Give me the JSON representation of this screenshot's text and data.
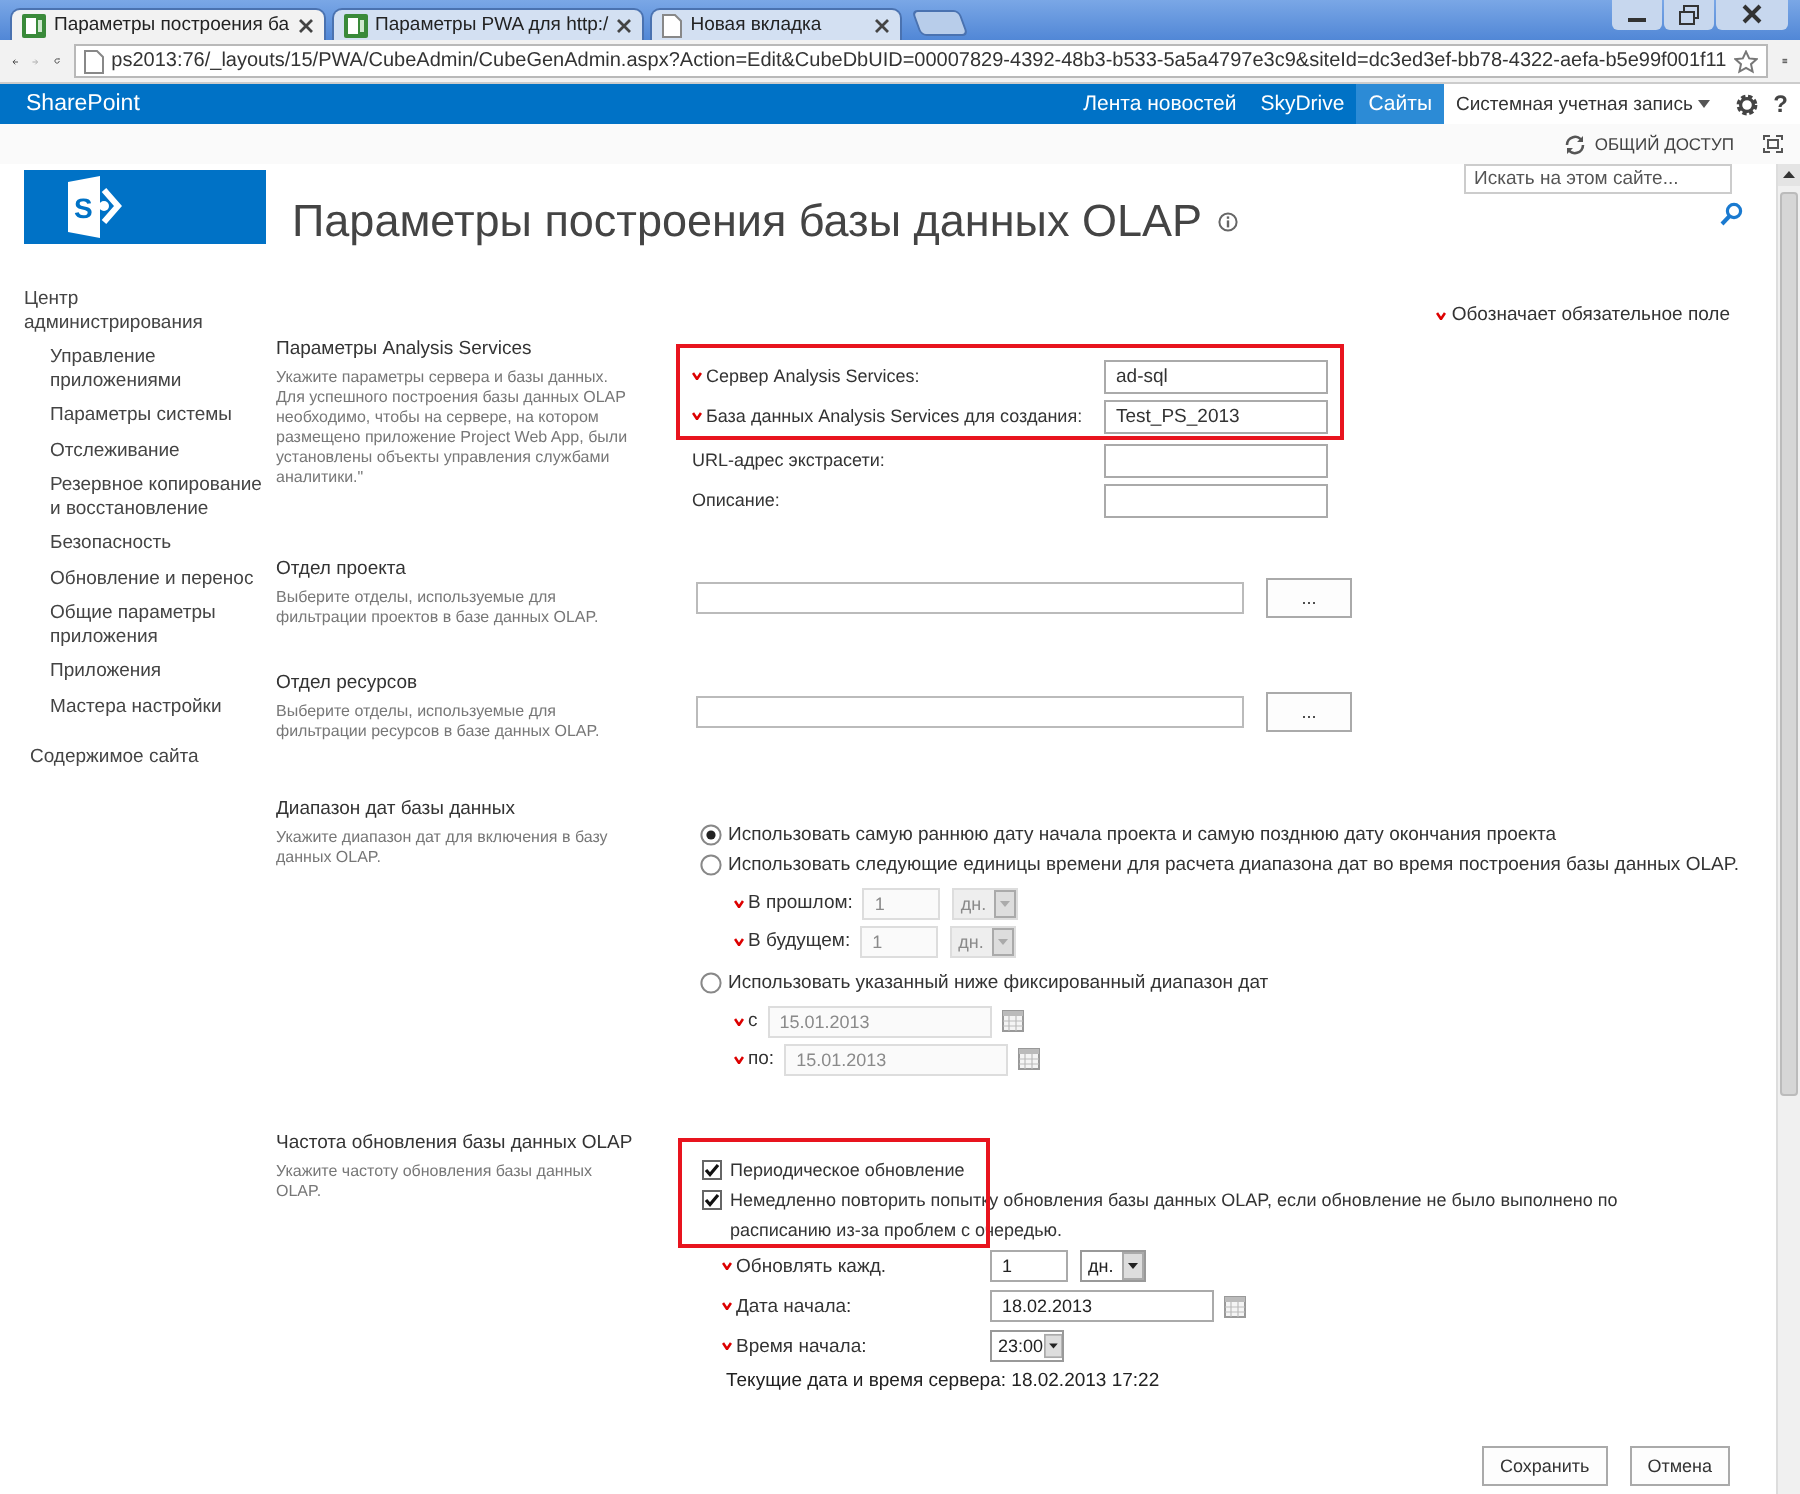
{
  "browser": {
    "tabs": [
      {
        "label": "Параметры построения ба",
        "selected": true
      },
      {
        "label": "Параметры PWA для http:/",
        "selected": false
      },
      {
        "label": "Новая вкладка",
        "selected": false
      }
    ],
    "url": "ps2013:76/_layouts/15/PWA/CubeAdmin/CubeGenAdmin.aspx?Action=Edit&CubeDbUID=00007829-4392-48b3-b533-5a5a4797e3c9&siteId=dc3ed3ef-bb78-4322-aefa-b5e99f001f11"
  },
  "suite_bar": {
    "brand": "SharePoint",
    "links": [
      {
        "label": "Лента новостей",
        "selected": false
      },
      {
        "label": "SkyDrive",
        "selected": false
      },
      {
        "label": "Сайты",
        "selected": true
      }
    ],
    "user": "Системная учетная запись",
    "help": "?"
  },
  "share": "ОБЩИЙ ДОСТУП",
  "logo_letter": "S",
  "page_title": "Параметры построения базы данных OLAP",
  "search": {
    "placeholder": "Искать на этом сайте..."
  },
  "nav": {
    "title": "Центр администрирования",
    "items": [
      "Управление приложениями",
      "Параметры системы",
      "Отслеживание",
      "Резервное копирование и восстановление",
      "Безопасность",
      "Обновление и перенос",
      "Общие параметры приложения",
      "Приложения",
      "Мастера настройки"
    ],
    "footer": "Содержимое сайта"
  },
  "required_note": "Обозначает обязательное поле",
  "sections": [
    {
      "kind": "fields",
      "title": "Параметры Analysis Services",
      "description": "Укажите параметры сервера и базы данных. Для успешного построения базы данных OLAP необходимо, чтобы на сервере, на котором размещено приложение Project Web App, были установлены объекты управления службами аналитики.\"",
      "fields": [
        {
          "label": "Сервер Analysis Services:",
          "required": true,
          "value": "ad-sql",
          "highlighted": true
        },
        {
          "label": "База данных Analysis Services для создания:",
          "required": true,
          "value": "Test_PS_2013",
          "highlighted": true
        },
        {
          "label": "URL-адрес экстрасети:",
          "required": false,
          "highlighted": false
        },
        {
          "label": "Описание:",
          "required": false,
          "highlighted": false
        }
      ]
    },
    {
      "kind": "picker",
      "title": "Отдел проекта",
      "description": "Выберите отделы, используемые для фильтрации проектов в базе данных OLAP.",
      "button": "..."
    },
    {
      "kind": "picker",
      "title": "Отдел ресурсов",
      "description": "Выберите отделы, используемые для фильтрации ресурсов в базе данных OLAP.",
      "button": "..."
    },
    {
      "kind": "date_range",
      "title": "Диапазон дат базы данных",
      "description": "Укажите диапазон дат для включения в базу данных OLAP.",
      "options": [
        {
          "label": "Использовать самую раннюю дату начала проекта и самую позднюю дату окончания проекта",
          "selected": true
        },
        {
          "label": "Использовать следующие единицы времени для расчета диапазона дат во время построения базы данных OLAP.",
          "selected": false,
          "fields": [
            {
              "kind": "number_unit",
              "label": "В прошлом:",
              "required": true,
              "value": "1",
              "unit": "дн.",
              "disabled": true
            },
            {
              "kind": "number_unit",
              "label": "В будущем:",
              "required": true,
              "value": "1",
              "unit": "дн.",
              "disabled": true
            }
          ]
        },
        {
          "label": "Использовать указанный ниже фиксированный диапазон дат",
          "selected": false,
          "fields": [
            {
              "kind": "date",
              "label": "с",
              "required": true,
              "value": "15.01.2013",
              "disabled": true
            },
            {
              "kind": "date",
              "label": "по:",
              "required": true,
              "value": "15.01.2013",
              "disabled": true
            }
          ]
        }
      ]
    },
    {
      "kind": "refresh",
      "title": "Частота обновления базы данных OLAP",
      "description": "Укажите частоту обновления базы данных OLAP.",
      "checks": [
        {
          "label": "Периодическое обновление",
          "checked": true,
          "highlighted": true
        },
        {
          "label": "Немедленно повторить попытку обновления базы данных OLAP, если обновление не было выполнено по расписанию из-за проблем с очередью.",
          "checked": true,
          "highlighted": true
        }
      ],
      "fields": [
        {
          "kind": "number_unit",
          "label": "Обновлять кажд.",
          "required": true,
          "value": "1",
          "unit": "дн.",
          "disabled": false
        },
        {
          "kind": "date",
          "label": "Дата начала:",
          "required": true,
          "value": "18.02.2013",
          "disabled": false
        },
        {
          "kind": "select",
          "label": "Время начала:",
          "required": true,
          "value": "23:00",
          "disabled": false
        }
      ],
      "server_time": "Текущие дата и время сервера: 18.02.2013 17:22"
    }
  ],
  "buttons": [
    "Сохранить",
    "Отмена"
  ]
}
